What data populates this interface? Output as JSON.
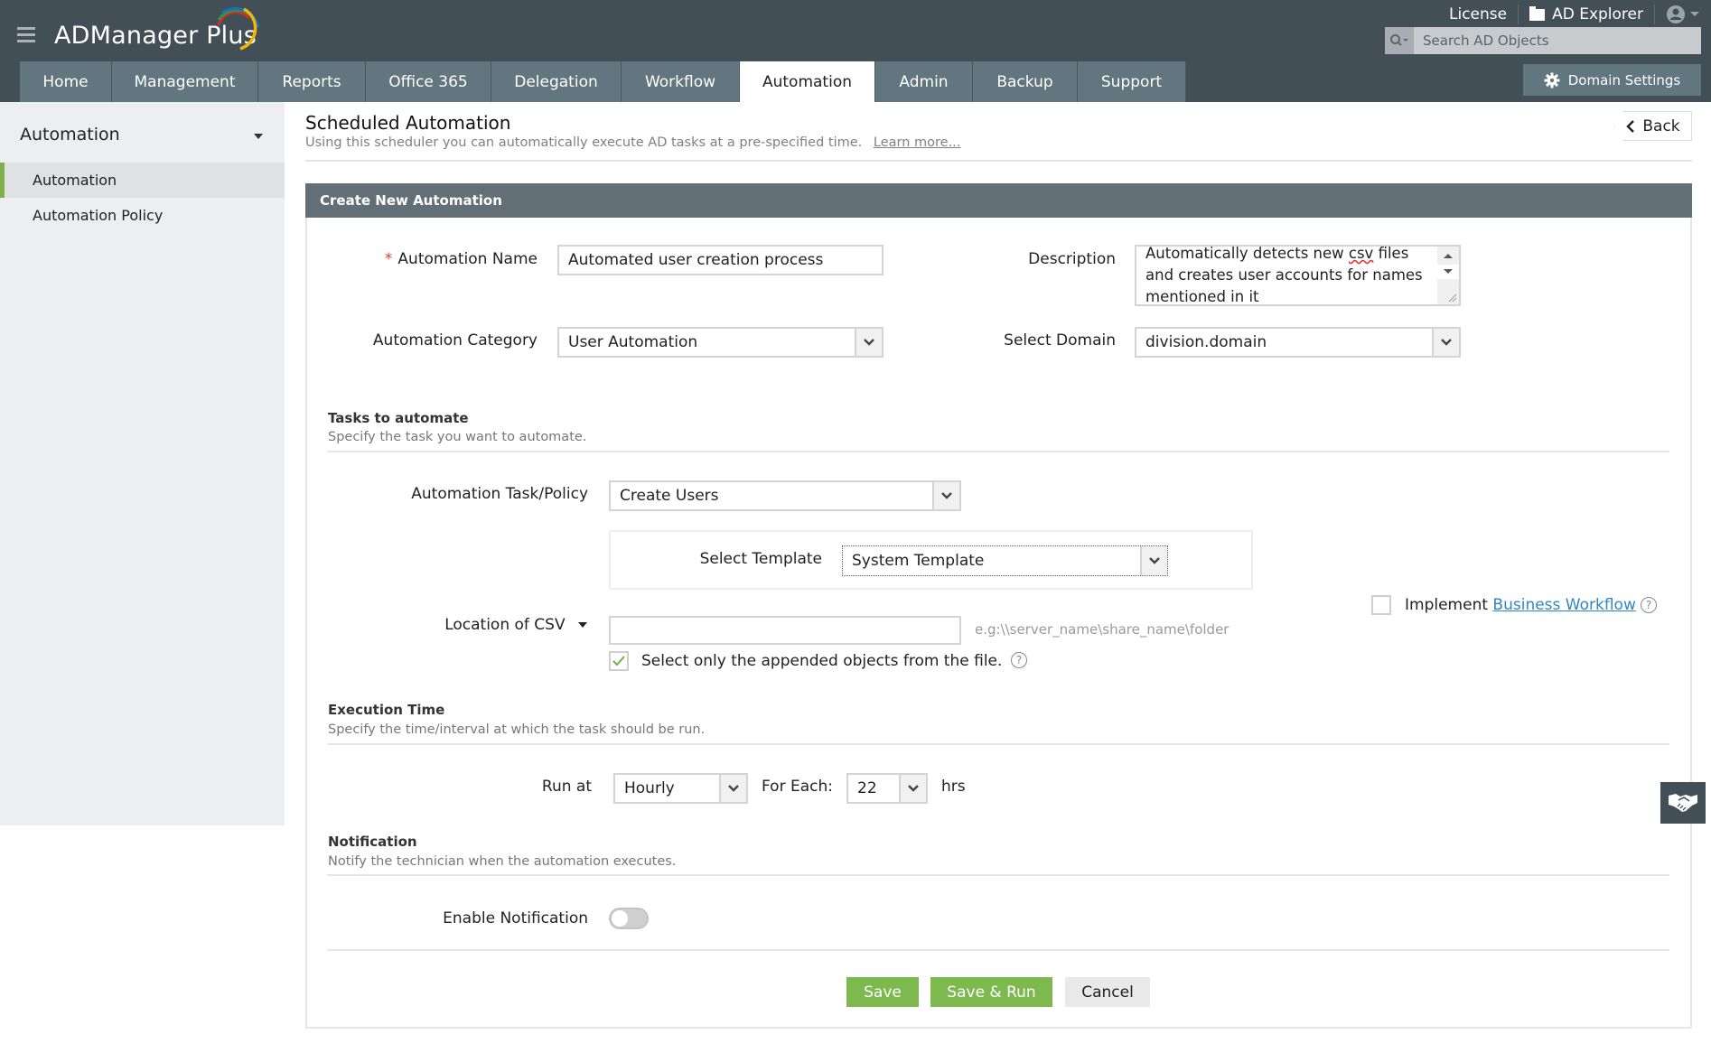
{
  "app": {
    "logo": "ADManager Plus"
  },
  "top_links": {
    "license": "License",
    "ad_explorer": "AD Explorer"
  },
  "search": {
    "placeholder": "Search AD Objects"
  },
  "tabs": [
    {
      "label": "Home",
      "active": false
    },
    {
      "label": "Management",
      "active": false
    },
    {
      "label": "Reports",
      "active": false
    },
    {
      "label": "Office 365",
      "active": false
    },
    {
      "label": "Delegation",
      "active": false
    },
    {
      "label": "Workflow",
      "active": false
    },
    {
      "label": "Automation",
      "active": true
    },
    {
      "label": "Admin",
      "active": false
    },
    {
      "label": "Backup",
      "active": false
    },
    {
      "label": "Support",
      "active": false
    }
  ],
  "domain_settings": "Domain Settings",
  "sidebar": {
    "title": "Automation",
    "items": [
      {
        "label": "Automation",
        "active": true
      },
      {
        "label": "Automation Policy",
        "active": false
      }
    ]
  },
  "page": {
    "title": "Scheduled Automation",
    "subtitle": "Using this scheduler you can automatically execute AD tasks at a pre-specified time.",
    "learn_more": "Learn more...",
    "back": "Back"
  },
  "panel": {
    "title": "Create New Automation"
  },
  "form": {
    "automation_name_label": "Automation Name",
    "automation_name_value": "Automated user creation process",
    "description_label": "Description",
    "description_lines": [
      "Automatically detects new ",
      "csv",
      " files",
      "and creates user accounts for names",
      "mentioned in it"
    ],
    "category_label": "Automation Category",
    "category_value": "User Automation",
    "domain_label": "Select Domain",
    "domain_value": "division.domain"
  },
  "tasks": {
    "title": "Tasks to automate",
    "subtitle": "Specify the task you want to automate.",
    "task_label": "Automation Task/Policy",
    "task_value": "Create Users",
    "template_label": "Select Template",
    "template_value": "System Template",
    "csv_label": "Location of CSV",
    "csv_value": "",
    "csv_hint": "e.g:\\\\server_name\\share_name\\folder",
    "appended_label": "Select only the appended objects from the file.",
    "appended_checked": true,
    "workflow_prefix": "Implement",
    "workflow_link": "Business Workflow",
    "workflow_checked": false
  },
  "execution": {
    "title": "Execution Time",
    "subtitle": "Specify the time/interval at which the task should be run.",
    "run_at_label": "Run at",
    "run_at_value": "Hourly",
    "for_each_label": "For Each:",
    "for_each_value": "22",
    "unit": "hrs"
  },
  "notification": {
    "title": "Notification",
    "subtitle": "Notify the technician when the automation executes.",
    "enable_label": "Enable Notification",
    "enabled": false
  },
  "buttons": {
    "save": "Save",
    "save_run": "Save & Run",
    "cancel": "Cancel"
  },
  "colors": {
    "header_bg": "#434f57",
    "tab_bg": "#62767f",
    "accent_green": "#7eb94f",
    "link_blue": "#2f86c4"
  }
}
